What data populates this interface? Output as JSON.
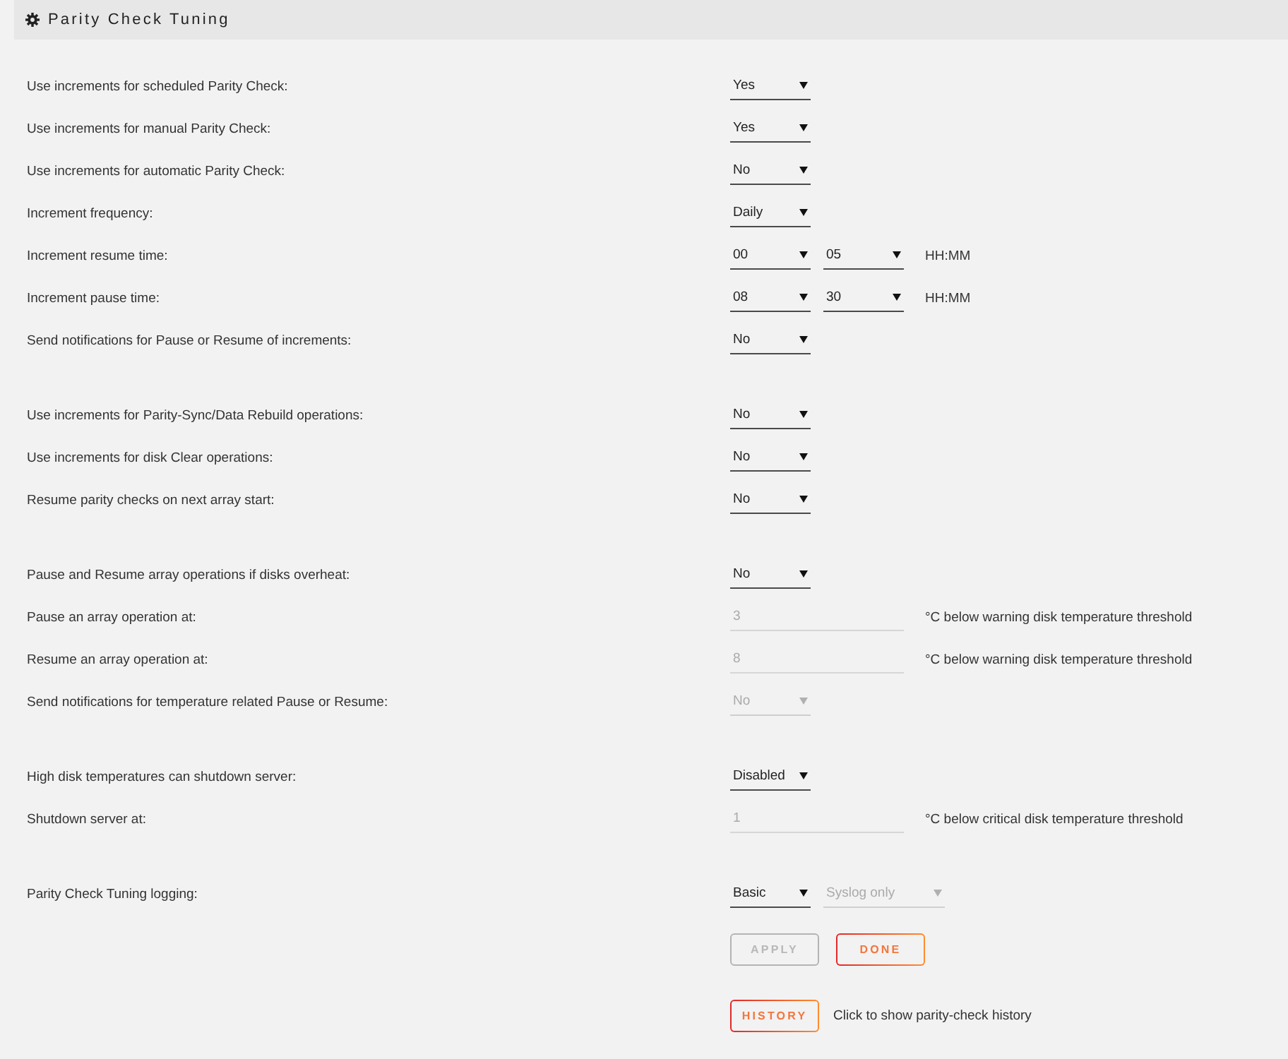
{
  "panel": {
    "title": "Parity Check Tuning"
  },
  "sections": [
    {
      "rows": [
        {
          "label": "Use increments for scheduled Parity Check:",
          "controls": [
            {
              "kind": "select",
              "value": "Yes",
              "disabled": false
            }
          ]
        },
        {
          "label": "Use increments for manual Parity Check:",
          "controls": [
            {
              "kind": "select",
              "value": "Yes",
              "disabled": false
            }
          ]
        },
        {
          "label": "Use increments for automatic Parity Check:",
          "controls": [
            {
              "kind": "select",
              "value": "No",
              "disabled": false
            }
          ]
        },
        {
          "label": "Increment frequency:",
          "controls": [
            {
              "kind": "select",
              "value": "Daily",
              "disabled": false
            }
          ]
        },
        {
          "label": "Increment resume time:",
          "controls": [
            {
              "kind": "select",
              "value": "00",
              "disabled": false
            },
            {
              "kind": "select",
              "value": "05",
              "disabled": false
            }
          ],
          "suffix": "HH:MM"
        },
        {
          "label": "Increment pause time:",
          "controls": [
            {
              "kind": "select",
              "value": "08",
              "disabled": false
            },
            {
              "kind": "select",
              "value": "30",
              "disabled": false
            }
          ],
          "suffix": "HH:MM"
        },
        {
          "label": "Send notifications for Pause or Resume of increments:",
          "controls": [
            {
              "kind": "select",
              "value": "No",
              "disabled": false
            }
          ]
        }
      ]
    },
    {
      "rows": [
        {
          "label": "Use increments for Parity-Sync/Data Rebuild operations:",
          "controls": [
            {
              "kind": "select",
              "value": "No",
              "disabled": false
            }
          ]
        },
        {
          "label": "Use increments for disk Clear operations:",
          "controls": [
            {
              "kind": "select",
              "value": "No",
              "disabled": false
            }
          ]
        },
        {
          "label": "Resume parity checks on next array start:",
          "controls": [
            {
              "kind": "select",
              "value": "No",
              "disabled": false
            }
          ]
        }
      ]
    },
    {
      "rows": [
        {
          "label": "Pause and Resume array operations if disks overheat:",
          "controls": [
            {
              "kind": "select",
              "value": "No",
              "disabled": false
            }
          ]
        },
        {
          "label": "Pause an array operation at:",
          "controls": [
            {
              "kind": "input",
              "value": "3",
              "disabled": true
            }
          ],
          "suffix": "°C below warning disk temperature threshold"
        },
        {
          "label": "Resume an array operation at:",
          "controls": [
            {
              "kind": "input",
              "value": "8",
              "disabled": true
            }
          ],
          "suffix": "°C below warning disk temperature threshold"
        },
        {
          "label": "Send notifications for temperature related Pause or Resume:",
          "controls": [
            {
              "kind": "select",
              "value": "No",
              "disabled": true
            }
          ]
        }
      ]
    },
    {
      "rows": [
        {
          "label": "High disk temperatures can shutdown server:",
          "controls": [
            {
              "kind": "select",
              "value": "Disabled",
              "disabled": false
            }
          ]
        },
        {
          "label": "Shutdown server at:",
          "controls": [
            {
              "kind": "input",
              "value": "1",
              "disabled": true
            }
          ],
          "suffix": "°C below critical disk temperature threshold"
        }
      ]
    },
    {
      "rows": [
        {
          "label": "Parity Check Tuning logging:",
          "controls": [
            {
              "kind": "select",
              "value": "Basic",
              "disabled": false
            },
            {
              "kind": "wide-select",
              "value": "Syslog only",
              "disabled": true
            }
          ]
        }
      ]
    }
  ],
  "actions": [
    {
      "label": "APPLY",
      "disabled": true
    },
    {
      "label": "DONE",
      "disabled": false
    }
  ],
  "history": {
    "button": {
      "label": "HISTORY"
    },
    "text": "Click to show parity-check history"
  }
}
